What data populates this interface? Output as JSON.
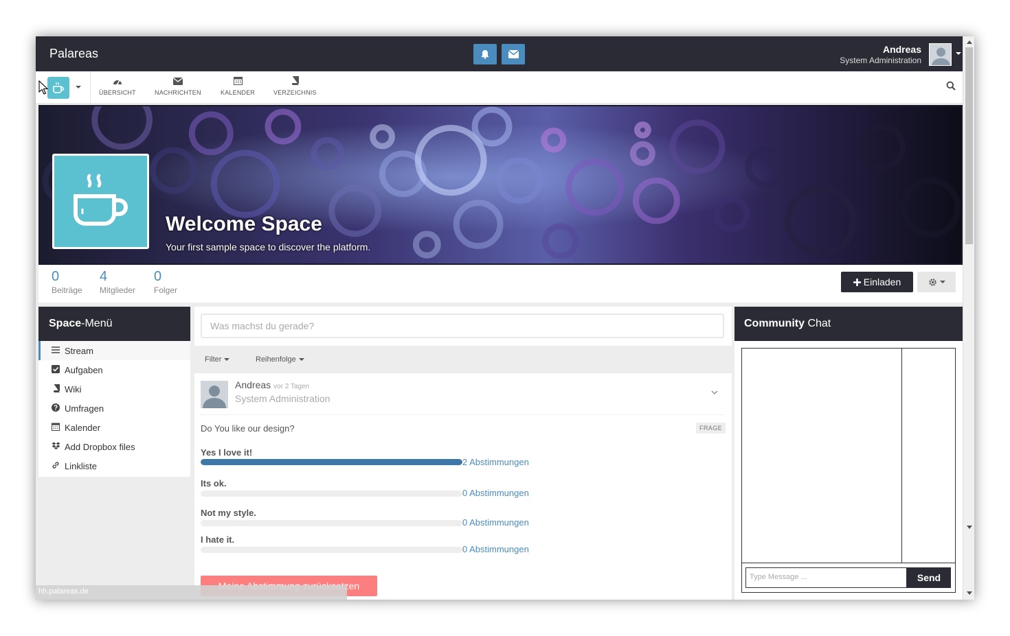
{
  "topbar": {
    "brand": "Palareas",
    "notifications_icon": "bell-icon",
    "messages_icon": "envelope-icon",
    "user_name": "Andreas",
    "user_role": "System Administration"
  },
  "nav": {
    "items": [
      {
        "label": "ÜBERSICHT",
        "icon": "dashboard-icon"
      },
      {
        "label": "NACHRICHTEN",
        "icon": "envelope-icon"
      },
      {
        "label": "KALENDER",
        "icon": "calendar-icon"
      },
      {
        "label": "VERZEICHNIS",
        "icon": "book-icon"
      }
    ],
    "search_icon": "search-icon"
  },
  "banner": {
    "title": "Welcome Space",
    "subtitle": "Your first sample space to discover the platform."
  },
  "stats": [
    {
      "value": "0",
      "label": "Beiträge"
    },
    {
      "value": "4",
      "label": "Mitglieder"
    },
    {
      "value": "0",
      "label": "Folger"
    }
  ],
  "actions": {
    "invite_label": "Einladen"
  },
  "space_menu": {
    "title_bold": "Space",
    "title_rest": "-Menü",
    "items": [
      {
        "label": "Stream",
        "icon": "list-icon",
        "active": true
      },
      {
        "label": "Aufgaben",
        "icon": "checkbox-icon"
      },
      {
        "label": "Wiki",
        "icon": "book-icon"
      },
      {
        "label": "Umfragen",
        "icon": "question-icon"
      },
      {
        "label": "Kalender",
        "icon": "calendar-icon"
      },
      {
        "label": "Add Dropbox files",
        "icon": "dropbox-icon"
      },
      {
        "label": "Linkliste",
        "icon": "link-icon"
      }
    ]
  },
  "stream": {
    "placeholder": "Was machst du gerade?",
    "filter_label": "Filter",
    "sort_label": "Reihenfolge",
    "post": {
      "author": "Andreas",
      "time": "vor 2 Tagen",
      "role": "System Administration",
      "question": "Do You like our design?",
      "badge": "FRAGE",
      "answers": [
        {
          "label": "Yes I love it!",
          "votes": "2 Abstimmungen",
          "share": 1.0
        },
        {
          "label": "Its ok.",
          "votes": "0 Abstimmungen",
          "share": 0
        },
        {
          "label": "Not my style.",
          "votes": "0 Abstimmungen",
          "share": 0
        },
        {
          "label": "I hate it.",
          "votes": "0 Abstimmungen",
          "share": 0
        }
      ],
      "reset_label": "Meine Abstimmung zurücksetzen"
    }
  },
  "statusbar": {
    "url": "hh.palareas.de"
  },
  "chat": {
    "title_bold": "Community",
    "title_rest": " Chat",
    "input_placeholder": "Type Message ...",
    "send_label": "Send"
  },
  "colors": {
    "dark": "#2a2b35",
    "accent": "#4a8cbd",
    "teal": "#5bc0cf",
    "danger": "#fc7e7e"
  }
}
